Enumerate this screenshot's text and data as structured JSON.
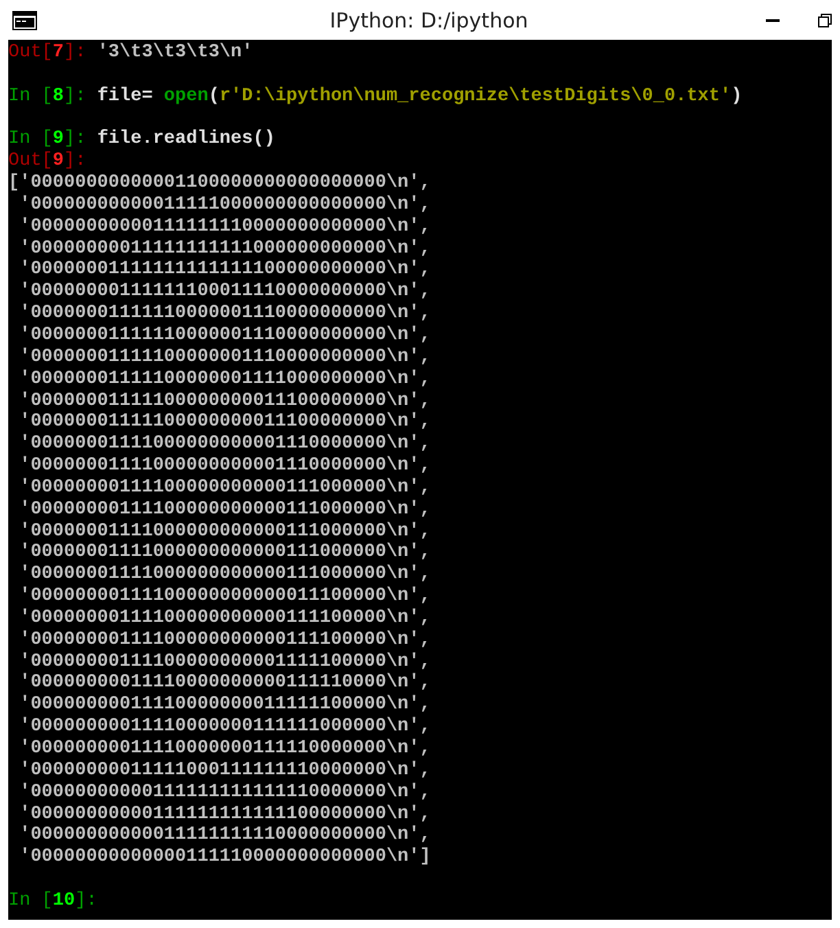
{
  "window": {
    "title": "IPython: D:/ipython"
  },
  "console": [
    {
      "kind": "out",
      "prompt": {
        "prefix": "Out[",
        "number": "7",
        "suffix": "]:"
      },
      "text": "'3\\t3\\t3\\t3\\n'"
    },
    {
      "kind": "blank"
    },
    {
      "kind": "in",
      "prompt": {
        "prefix": "In [",
        "number": "8",
        "suffix": "]:"
      },
      "tokens": [
        {
          "kind": "plain",
          "text": "file= "
        },
        {
          "kind": "builtin",
          "text": "open"
        },
        {
          "kind": "plain",
          "text": "("
        },
        {
          "kind": "string",
          "text": "r'D:\\ipython\\num_recognize\\testDigits\\0_0.txt'"
        },
        {
          "kind": "plain",
          "text": ")"
        }
      ]
    },
    {
      "kind": "blank"
    },
    {
      "kind": "in",
      "prompt": {
        "prefix": "In [",
        "number": "9",
        "suffix": "]:"
      },
      "tokens": [
        {
          "kind": "plain",
          "text": "file.readlines()"
        }
      ]
    },
    {
      "kind": "out",
      "prompt": {
        "prefix": "Out[",
        "number": "9",
        "suffix": "]:"
      }
    },
    {
      "kind": "lines",
      "lines": [
        "['00000000000001100000000000000000\\n',",
        " '00000000000011111000000000000000\\n',",
        " '00000000000111111110000000000000\\n',",
        " '00000000011111111111000000000000\\n',",
        " '00000001111111111111100000000000\\n',",
        " '00000000111111100011110000000000\\n',",
        " '00000001111110000001110000000000\\n',",
        " '00000001111110000001110000000000\\n',",
        " '00000001111100000001110000000000\\n',",
        " '00000001111100000001111000000000\\n',",
        " '00000001111100000000011100000000\\n',",
        " '00000001111100000000011100000000\\n',",
        " '00000001111000000000001110000000\\n',",
        " '00000001111000000000001110000000\\n',",
        " '00000000111100000000000111000000\\n',",
        " '00000000111100000000000111000000\\n',",
        " '00000001111000000000000111000000\\n',",
        " '00000001111000000000000111000000\\n',",
        " '00000001111000000000000111000000\\n',",
        " '00000000111100000000000011100000\\n',",
        " '00000000111100000000000111100000\\n',",
        " '00000000111100000000000111100000\\n',",
        " '00000000111100000000001111100000\\n',",
        " '00000000011110000000000111110000\\n',",
        " '00000000011110000000011111100000\\n',",
        " '00000000011110000000111111000000\\n',",
        " '00000000011110000000111110000000\\n',",
        " '00000000011111000111111110000000\\n',",
        " '00000000000111111111111110000000\\n',",
        " '00000000000111111111111100000000\\n',",
        " '00000000000011111111110000000000\\n',",
        " '00000000000000111110000000000000\\n']"
      ]
    },
    {
      "kind": "blank"
    },
    {
      "kind": "in",
      "prompt": {
        "prefix": "In [",
        "number": "10",
        "suffix": "]:"
      }
    }
  ]
}
